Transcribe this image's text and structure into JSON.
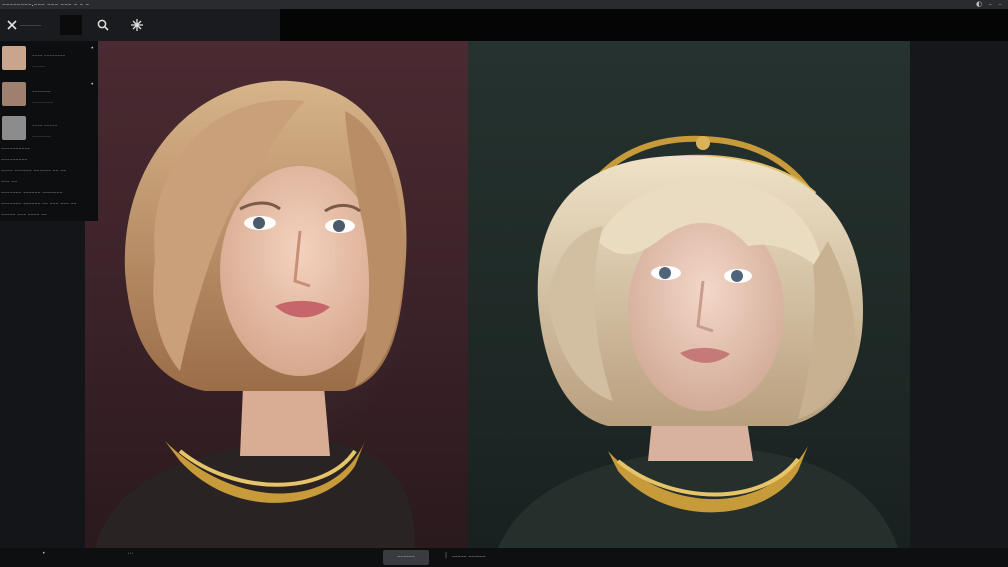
{
  "window": {
    "title": "₋₋₋₋₋₋₋₋.₋₋₋ ₋₋₋ ₋₋₋ ₋ ₋ ₋",
    "controls": "◐ ₋ ₋"
  },
  "toolbar": {
    "search_label": "₋₋₋₋₋₋₋₋",
    "icons": [
      "close-icon",
      "search-icon",
      "sparkle-icon"
    ]
  },
  "sidebar": {
    "layers": [
      {
        "name": "₋₋₋₋ ₋₋₋₋₋₋₋₋",
        "sub": "₋₋₋₋₋",
        "thumb_color": "#c9a58e"
      },
      {
        "name": "₋₋₋₋₋₋₋",
        "sub": "₋₋₋₋₋₋₋₋",
        "thumb_color": "#9f7f6d"
      },
      {
        "name": "₋₋₋₋ ₋₋₋₋₋",
        "sub": "₋₋₋₋₋₋₋",
        "thumb_color": "#8c8c8c"
      }
    ],
    "meta": [
      "₋₋₋₋₋₋₋₋₋₋",
      "₋₋₋₋₋₋₋₋₋",
      "₋₋₋₋ ₋₋₋₋₋₋ ₋₋₋₋₋₋ ₋₋ ₋₋",
      "₋₋₋ ₋₋",
      "₋₋₋₋₋₋₋ ₋₋₋₋₋₋ ₋₋₋₋₋₋₋",
      "₋₋₋₋₋₋₋ ₋₋₋₋₋₋ ₋₋ ₋₋₋ ₋₋₋ ₋₋",
      "₋₋₋₋₋ ₋₋₋ ₋₋₋₋ ₋₋"
    ]
  },
  "images": {
    "left_bg": "#3a2228",
    "right_bg": "#1f2a27",
    "hair_left": "#c59a6e",
    "hair_right": "#d8c6a8",
    "skin": "#e7c0a8",
    "collar": "#c79a3a"
  },
  "bottom": {
    "left_marks": "• ⋯",
    "active_tab": "₋₋₋₋₋₋",
    "separator": "|",
    "inactive_tab": "₋₋₋₋₋ ₋₋₋₋₋₋"
  }
}
